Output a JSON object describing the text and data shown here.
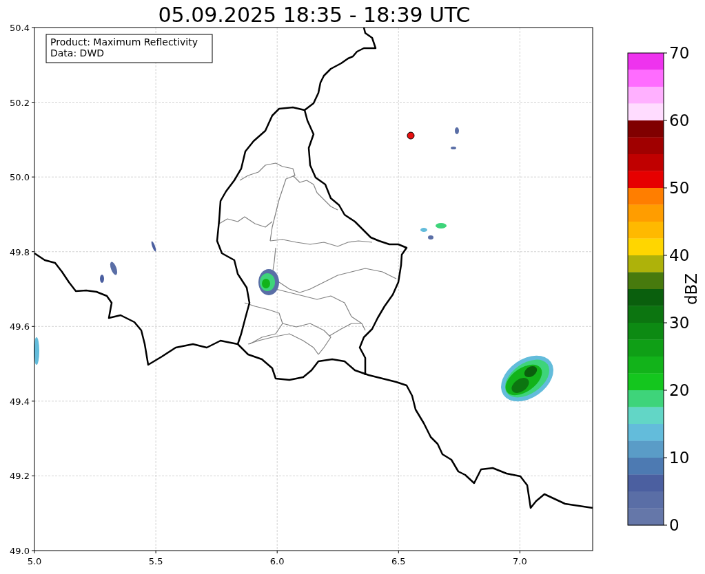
{
  "title": "05.09.2025 18:35 - 18:39 UTC",
  "info_box": {
    "lines": [
      "Product: Maximum Reflectivity",
      "Data: DWD"
    ]
  },
  "map": {
    "x_ticks": [
      "5.0",
      "5.5",
      "6.0",
      "6.5",
      "7.0"
    ],
    "y_ticks": [
      "50.4",
      "50.2",
      "50.0",
      "49.8",
      "49.6",
      "49.4",
      "49.2",
      "49.0"
    ]
  },
  "colorbar": {
    "label": "dBZ",
    "ticks": [
      "70",
      "60",
      "50",
      "40",
      "30",
      "20",
      "10",
      "0"
    ],
    "bands": [
      {
        "color": "#ee33ee"
      },
      {
        "color": "#ff6cff"
      },
      {
        "color": "#ffb0ff"
      },
      {
        "color": "#ffdcff"
      },
      {
        "color": "#800000"
      },
      {
        "color": "#a00000"
      },
      {
        "color": "#c00000"
      },
      {
        "color": "#e60000"
      },
      {
        "color": "#ff7e00"
      },
      {
        "color": "#ff9d00"
      },
      {
        "color": "#ffb900"
      },
      {
        "color": "#ffd600"
      },
      {
        "color": "#aeb20a"
      },
      {
        "color": "#477a0d"
      },
      {
        "color": "#0a5f0d"
      },
      {
        "color": "#0c7510"
      },
      {
        "color": "#0d8a13"
      },
      {
        "color": "#0f9f16"
      },
      {
        "color": "#12b31a"
      },
      {
        "color": "#14c61e"
      },
      {
        "color": "#3ed47a"
      },
      {
        "color": "#62d6c6"
      },
      {
        "color": "#63bcdb"
      },
      {
        "color": "#5a9cc7"
      },
      {
        "color": "#4d7ab2"
      },
      {
        "color": "#4b5fa0"
      },
      {
        "color": "#5a6ea6"
      },
      {
        "color": "#6577a9"
      }
    ]
  }
}
